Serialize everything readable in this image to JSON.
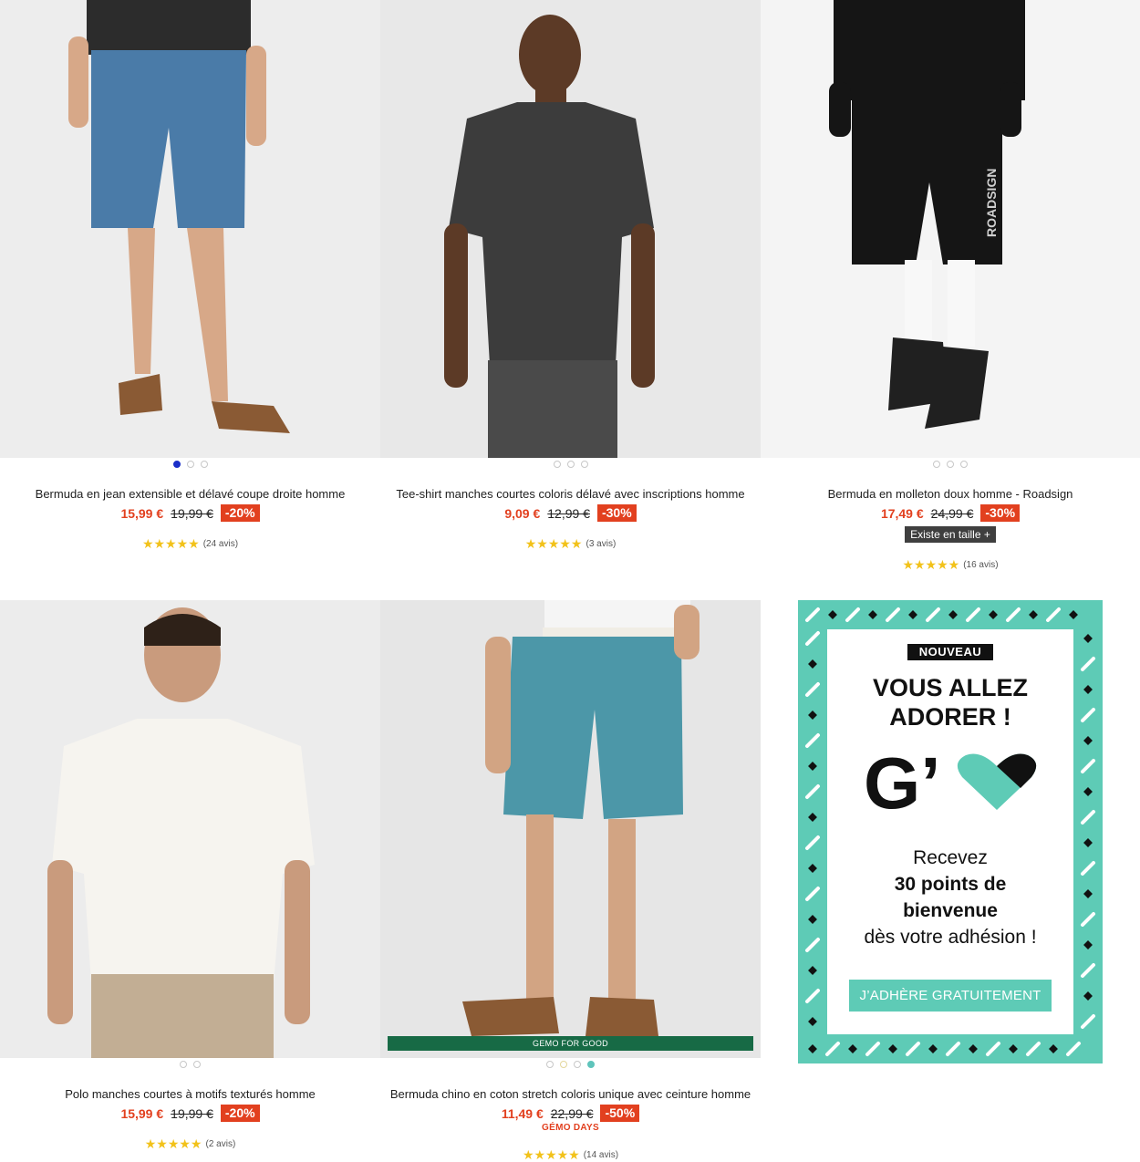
{
  "products": [
    {
      "title": "Bermuda en jean extensible et délavé coupe droite homme",
      "price": "15,99 €",
      "old_price": "19,99 €",
      "discount": "-20%",
      "stars": "★★★★★",
      "reviews": "(24 avis)",
      "rating": 5
    },
    {
      "title": "Tee-shirt manches courtes coloris délavé avec inscriptions homme",
      "price": "9,09 €",
      "old_price": "12,99 €",
      "discount": "-30%",
      "stars": "★★★★★",
      "reviews": "(3 avis)",
      "rating": 5
    },
    {
      "title": "Bermuda en molleton doux homme - Roadsign",
      "price": "17,49 €",
      "old_price": "24,99 €",
      "discount": "-30%",
      "size_tag": "Existe en taille +",
      "stars": "★★★★★",
      "reviews": "(16 avis)",
      "rating": 4.5
    },
    {
      "title": "Polo manches courtes à motifs texturés homme",
      "price": "15,99 €",
      "old_price": "19,99 €",
      "discount": "-20%",
      "stars": "★★★★★",
      "reviews": "(2 avis)",
      "rating": 4.5
    },
    {
      "title": "Bermuda chino en coton stretch coloris unique avec ceinture homme",
      "price": "11,49 €",
      "old_price": "22,99 €",
      "discount": "-50%",
      "banner": "GEMO FOR GOOD",
      "subtag": "GÉMO DAYS",
      "stars": "★★★★★",
      "reviews": "(14 avis)",
      "rating": 5
    }
  ],
  "promo": {
    "badge": "NOUVEAU",
    "headline_1": "VOUS ALLEZ",
    "headline_2": "ADORER !",
    "logo_text": "G’",
    "line_1": "Recevez",
    "line_2": "30 points de",
    "line_3": "bienvenue",
    "line_4": "dès votre adhésion !",
    "button": "J’ADHÈRE GRATUITEMENT"
  },
  "colors": {
    "price": "#e2401f",
    "promo_teal": "#5ecbb6",
    "gemo_green": "#176a45",
    "star": "#f2c21a"
  }
}
